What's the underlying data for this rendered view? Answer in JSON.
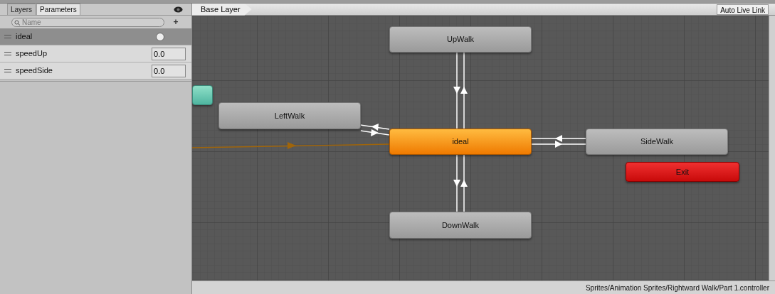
{
  "panel_tabs": [
    {
      "label": "Layers",
      "selected": false
    },
    {
      "label": "Parameters",
      "selected": true
    }
  ],
  "search": {
    "placeholder": "Name"
  },
  "add_button": "+",
  "parameters": [
    {
      "name": "ideal",
      "kind": "bool",
      "selected": true,
      "checked": false
    },
    {
      "name": "speedUp",
      "kind": "float",
      "selected": false,
      "value": "0.0"
    },
    {
      "name": "speedSide",
      "kind": "float",
      "selected": false,
      "value": "0.0"
    }
  ],
  "breadcrumb": "Base Layer",
  "auto_live_link": "Auto Live Link",
  "states": [
    {
      "kind": "entry"
    },
    {
      "kind": "state",
      "label": "UpWalk"
    },
    {
      "kind": "state",
      "label": "LeftWalk"
    },
    {
      "kind": "default",
      "label": "ideal"
    },
    {
      "kind": "state",
      "label": "SideWalk"
    },
    {
      "kind": "exit",
      "label": "Exit"
    },
    {
      "kind": "state",
      "label": "DownWalk"
    }
  ],
  "status_bar": "Sprites/Animation Sprites/Rightward Walk/Part 1.controller"
}
